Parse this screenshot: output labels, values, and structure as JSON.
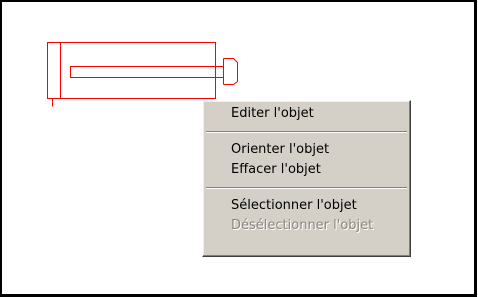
{
  "colors": {
    "symbol_stroke": "#ff0000",
    "menu_background": "#d4d0c8",
    "disabled_text": "#8b877f"
  },
  "canvas": {
    "symbol_name": "cylinder-icon"
  },
  "context_menu": {
    "items": [
      {
        "label": "Editer l'objet",
        "enabled": true
      },
      {
        "label": "Orienter l'objet",
        "enabled": true
      },
      {
        "label": "Effacer l'objet",
        "enabled": true
      },
      {
        "label": "Sélectionner l'objet",
        "enabled": true
      },
      {
        "label": "Désélectionner l'objet",
        "enabled": false
      }
    ]
  }
}
